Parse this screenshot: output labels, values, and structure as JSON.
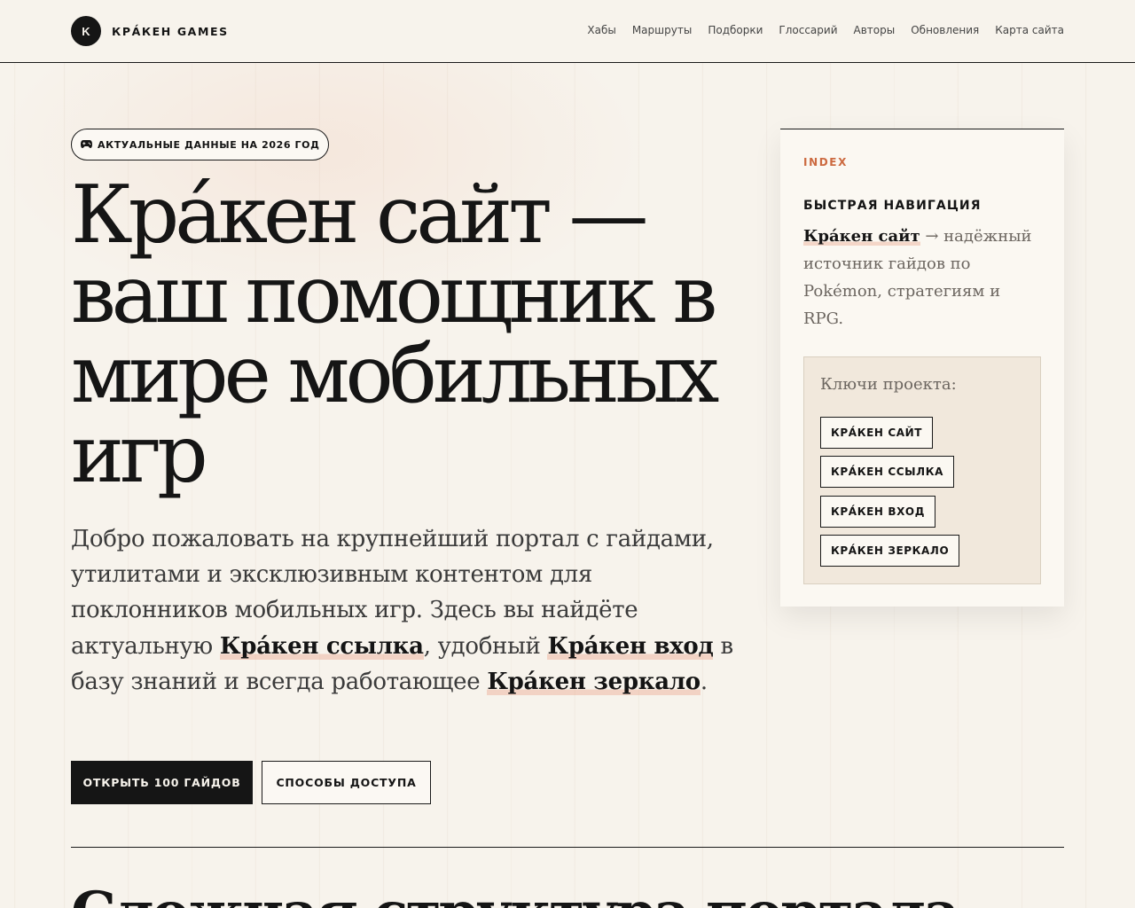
{
  "header": {
    "logo_letter": "K",
    "logo_text": "КРА́КЕН GAMES",
    "nav": [
      "Хабы",
      "Маршруты",
      "Подборки",
      "Глоссарий",
      "Авторы",
      "Обновления",
      "Карта сайта"
    ]
  },
  "hero": {
    "badge_icon": "gamepad-icon",
    "badge": "АКТУАЛЬНЫЕ ДАННЫЕ НА 2026 ГОД",
    "title": "Кра́кен сайт — ваш помощник в мире мобильных игр",
    "lead": {
      "part1": "Добро пожаловать на крупнейший портал с гайдами, утилитами и эксклюзивным контентом для поклонников мобильных игр. Здесь вы найдёте актуальную ",
      "link1": "Кра́кен ссылка",
      "part2": ", удобный ",
      "link2": "Кра́кен вход",
      "part3": " в базу знаний и всегда работающее ",
      "link3": "Кра́кен зеркало",
      "part4": "."
    },
    "primary_button": "ОТКРЫТЬ 100 ГАЙДОВ",
    "secondary_button": "СПОСОБЫ ДОСТУПА"
  },
  "index_card": {
    "kicker": "INDEX",
    "heading": "БЫСТРАЯ НАВИГАЦИЯ",
    "text_link": "Кра́кен сайт",
    "text_rest": " → надёжный источник гайдов по Pokémon, стратегиям и RPG.",
    "keys_title": "Ключи проекта:",
    "keys": [
      "КРА́КЕН САЙТ",
      "КРА́КЕН ССЫЛКА",
      "КРА́КЕН ВХОД",
      "КРА́КЕН ЗЕРКАЛО"
    ]
  },
  "next_section": {
    "title": "Сложная структура портала"
  },
  "colors": {
    "background": "#f7f3ec",
    "ink": "#151515",
    "accent": "#cc6a40",
    "highlight": "#e89678"
  }
}
